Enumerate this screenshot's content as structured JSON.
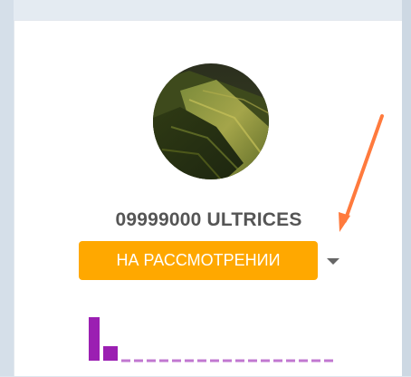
{
  "profile": {
    "name": "09999000 ULTRICES",
    "status": "НА РАССМОТРЕНИИ"
  },
  "icons": {
    "status_dropdown": "caret-down-icon",
    "annotation": "arrow-icon"
  },
  "colors": {
    "status_badge": "#ffa800",
    "chart_bars": "#9b1fb2",
    "annotation_arrow": "#ff7a3d"
  }
}
